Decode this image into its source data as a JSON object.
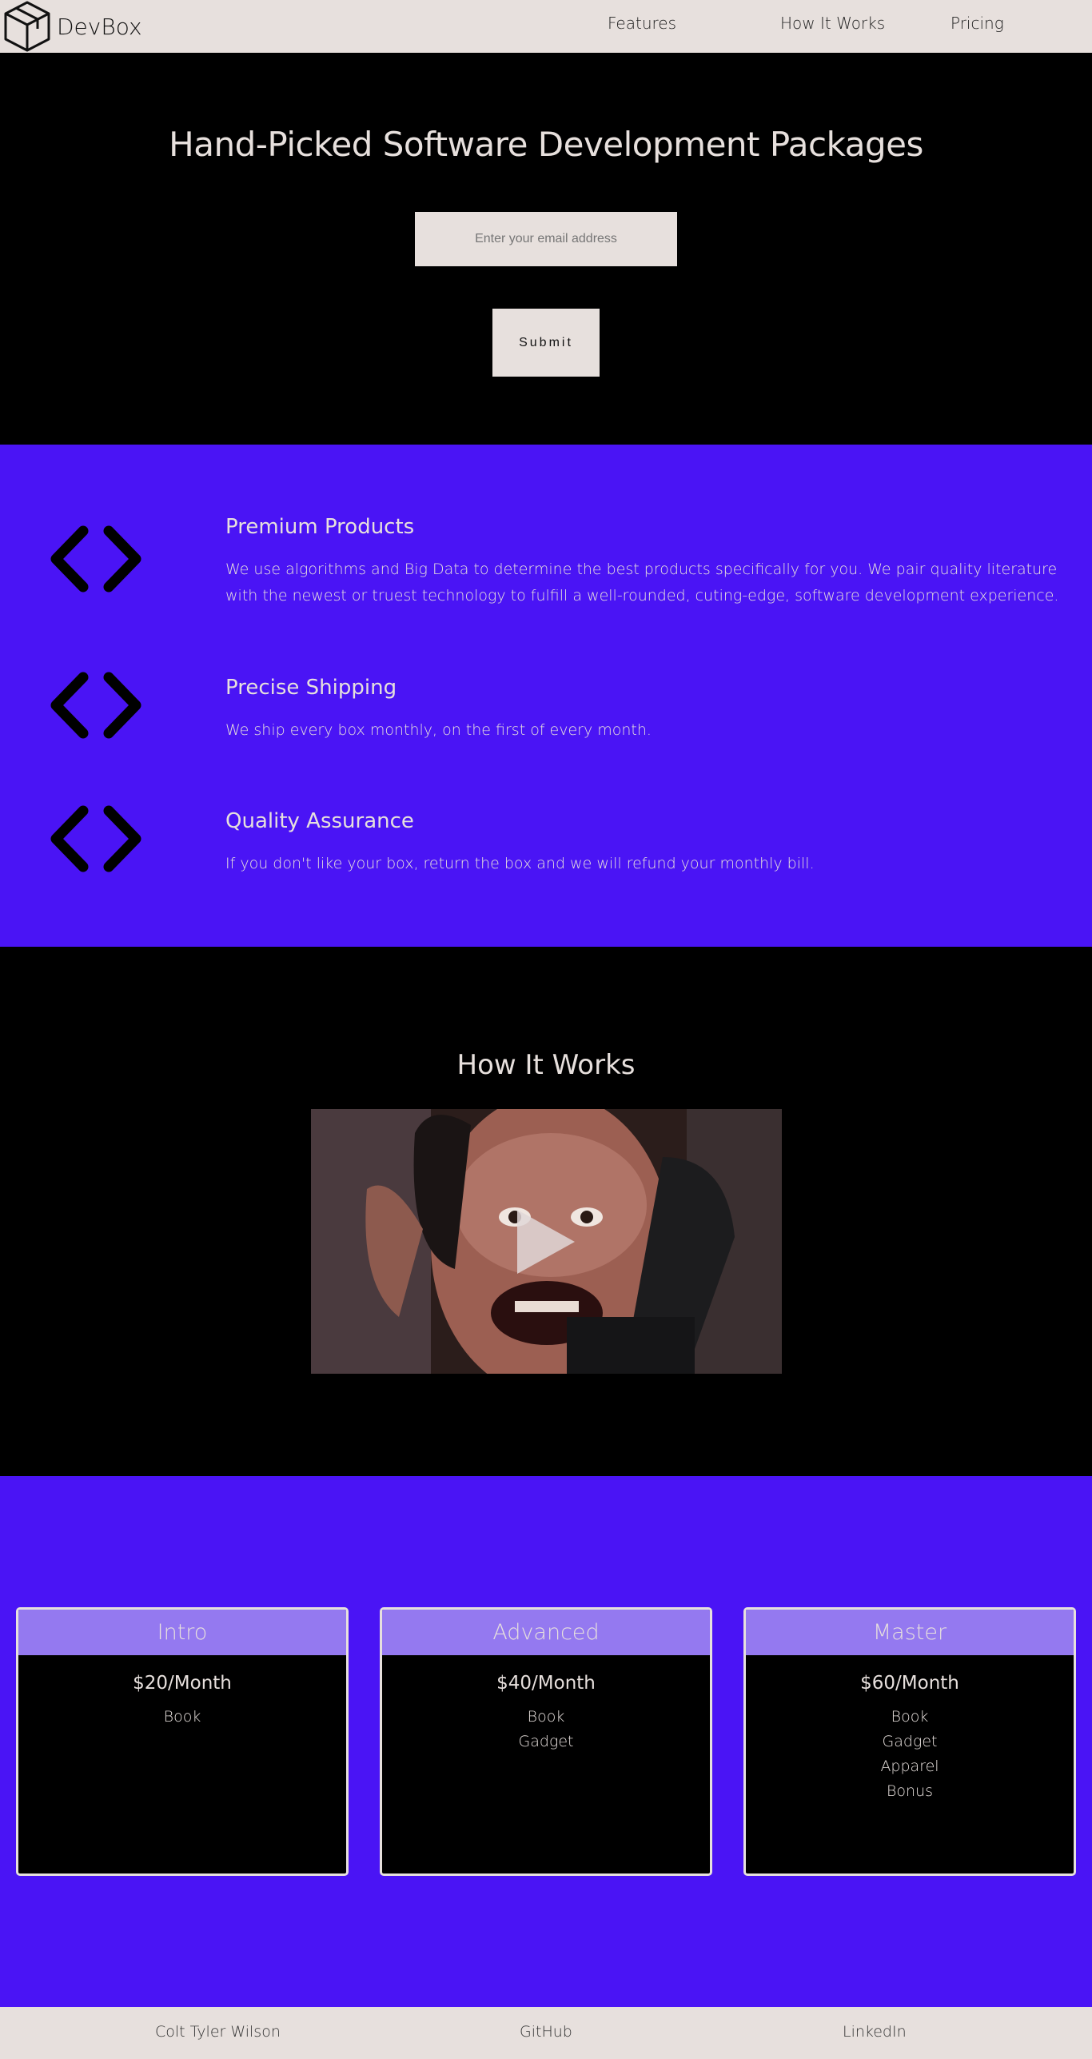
{
  "header": {
    "logo_text": "DevBox",
    "nav": [
      "Features",
      "How It Works",
      "Pricing"
    ]
  },
  "hero": {
    "title": "Hand-Picked Software Development Packages",
    "email_placeholder": "Enter your email address",
    "submit_label": "Submit"
  },
  "features": [
    {
      "icon": "code-brackets-icon",
      "title": "Premium Products",
      "text": "We use algorithms and Big Data to determine the best products specifically for you. We pair quality literature with the newest or truest technology to fulfill a well-rounded, cuting-edge, software development experience."
    },
    {
      "icon": "code-brackets-icon",
      "title": "Precise Shipping",
      "text": "We ship every box monthly, on the first of every month."
    },
    {
      "icon": "code-brackets-icon",
      "title": "Quality Assurance",
      "text": "If you don't like your box, return the box and we will refund your monthly bill."
    }
  ],
  "how": {
    "title": "How It Works",
    "video_icon": "play-icon"
  },
  "pricing": [
    {
      "name": "Intro",
      "price": "$20/Month",
      "items": [
        "Book"
      ]
    },
    {
      "name": "Advanced",
      "price": "$40/Month",
      "items": [
        "Book",
        "Gadget"
      ]
    },
    {
      "name": "Master",
      "price": "$60/Month",
      "items": [
        "Book",
        "Gadget",
        "Apparel",
        "Bonus"
      ]
    }
  ],
  "footer": {
    "links": [
      "Colt Tyler Wilson",
      "GitHub",
      "LinkedIn"
    ]
  },
  "colors": {
    "accent": "#4a14f5",
    "light": "#e7e0dd",
    "card_header": "#9479f0",
    "dark": "#000000"
  }
}
